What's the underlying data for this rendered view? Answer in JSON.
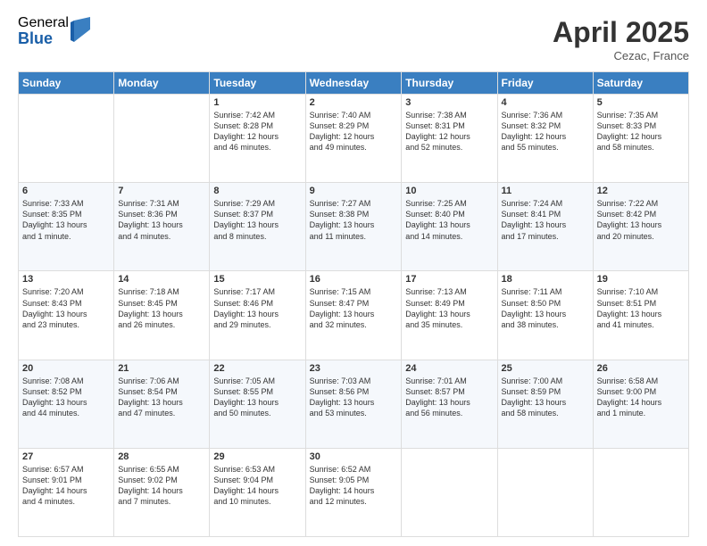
{
  "header": {
    "logo_general": "General",
    "logo_blue": "Blue",
    "month_title": "April 2025",
    "location": "Cezac, France"
  },
  "calendar": {
    "days": [
      "Sunday",
      "Monday",
      "Tuesday",
      "Wednesday",
      "Thursday",
      "Friday",
      "Saturday"
    ],
    "weeks": [
      [
        {
          "num": "",
          "lines": []
        },
        {
          "num": "",
          "lines": []
        },
        {
          "num": "1",
          "lines": [
            "Sunrise: 7:42 AM",
            "Sunset: 8:28 PM",
            "Daylight: 12 hours",
            "and 46 minutes."
          ]
        },
        {
          "num": "2",
          "lines": [
            "Sunrise: 7:40 AM",
            "Sunset: 8:29 PM",
            "Daylight: 12 hours",
            "and 49 minutes."
          ]
        },
        {
          "num": "3",
          "lines": [
            "Sunrise: 7:38 AM",
            "Sunset: 8:31 PM",
            "Daylight: 12 hours",
            "and 52 minutes."
          ]
        },
        {
          "num": "4",
          "lines": [
            "Sunrise: 7:36 AM",
            "Sunset: 8:32 PM",
            "Daylight: 12 hours",
            "and 55 minutes."
          ]
        },
        {
          "num": "5",
          "lines": [
            "Sunrise: 7:35 AM",
            "Sunset: 8:33 PM",
            "Daylight: 12 hours",
            "and 58 minutes."
          ]
        }
      ],
      [
        {
          "num": "6",
          "lines": [
            "Sunrise: 7:33 AM",
            "Sunset: 8:35 PM",
            "Daylight: 13 hours",
            "and 1 minute."
          ]
        },
        {
          "num": "7",
          "lines": [
            "Sunrise: 7:31 AM",
            "Sunset: 8:36 PM",
            "Daylight: 13 hours",
            "and 4 minutes."
          ]
        },
        {
          "num": "8",
          "lines": [
            "Sunrise: 7:29 AM",
            "Sunset: 8:37 PM",
            "Daylight: 13 hours",
            "and 8 minutes."
          ]
        },
        {
          "num": "9",
          "lines": [
            "Sunrise: 7:27 AM",
            "Sunset: 8:38 PM",
            "Daylight: 13 hours",
            "and 11 minutes."
          ]
        },
        {
          "num": "10",
          "lines": [
            "Sunrise: 7:25 AM",
            "Sunset: 8:40 PM",
            "Daylight: 13 hours",
            "and 14 minutes."
          ]
        },
        {
          "num": "11",
          "lines": [
            "Sunrise: 7:24 AM",
            "Sunset: 8:41 PM",
            "Daylight: 13 hours",
            "and 17 minutes."
          ]
        },
        {
          "num": "12",
          "lines": [
            "Sunrise: 7:22 AM",
            "Sunset: 8:42 PM",
            "Daylight: 13 hours",
            "and 20 minutes."
          ]
        }
      ],
      [
        {
          "num": "13",
          "lines": [
            "Sunrise: 7:20 AM",
            "Sunset: 8:43 PM",
            "Daylight: 13 hours",
            "and 23 minutes."
          ]
        },
        {
          "num": "14",
          "lines": [
            "Sunrise: 7:18 AM",
            "Sunset: 8:45 PM",
            "Daylight: 13 hours",
            "and 26 minutes."
          ]
        },
        {
          "num": "15",
          "lines": [
            "Sunrise: 7:17 AM",
            "Sunset: 8:46 PM",
            "Daylight: 13 hours",
            "and 29 minutes."
          ]
        },
        {
          "num": "16",
          "lines": [
            "Sunrise: 7:15 AM",
            "Sunset: 8:47 PM",
            "Daylight: 13 hours",
            "and 32 minutes."
          ]
        },
        {
          "num": "17",
          "lines": [
            "Sunrise: 7:13 AM",
            "Sunset: 8:49 PM",
            "Daylight: 13 hours",
            "and 35 minutes."
          ]
        },
        {
          "num": "18",
          "lines": [
            "Sunrise: 7:11 AM",
            "Sunset: 8:50 PM",
            "Daylight: 13 hours",
            "and 38 minutes."
          ]
        },
        {
          "num": "19",
          "lines": [
            "Sunrise: 7:10 AM",
            "Sunset: 8:51 PM",
            "Daylight: 13 hours",
            "and 41 minutes."
          ]
        }
      ],
      [
        {
          "num": "20",
          "lines": [
            "Sunrise: 7:08 AM",
            "Sunset: 8:52 PM",
            "Daylight: 13 hours",
            "and 44 minutes."
          ]
        },
        {
          "num": "21",
          "lines": [
            "Sunrise: 7:06 AM",
            "Sunset: 8:54 PM",
            "Daylight: 13 hours",
            "and 47 minutes."
          ]
        },
        {
          "num": "22",
          "lines": [
            "Sunrise: 7:05 AM",
            "Sunset: 8:55 PM",
            "Daylight: 13 hours",
            "and 50 minutes."
          ]
        },
        {
          "num": "23",
          "lines": [
            "Sunrise: 7:03 AM",
            "Sunset: 8:56 PM",
            "Daylight: 13 hours",
            "and 53 minutes."
          ]
        },
        {
          "num": "24",
          "lines": [
            "Sunrise: 7:01 AM",
            "Sunset: 8:57 PM",
            "Daylight: 13 hours",
            "and 56 minutes."
          ]
        },
        {
          "num": "25",
          "lines": [
            "Sunrise: 7:00 AM",
            "Sunset: 8:59 PM",
            "Daylight: 13 hours",
            "and 58 minutes."
          ]
        },
        {
          "num": "26",
          "lines": [
            "Sunrise: 6:58 AM",
            "Sunset: 9:00 PM",
            "Daylight: 14 hours",
            "and 1 minute."
          ]
        }
      ],
      [
        {
          "num": "27",
          "lines": [
            "Sunrise: 6:57 AM",
            "Sunset: 9:01 PM",
            "Daylight: 14 hours",
            "and 4 minutes."
          ]
        },
        {
          "num": "28",
          "lines": [
            "Sunrise: 6:55 AM",
            "Sunset: 9:02 PM",
            "Daylight: 14 hours",
            "and 7 minutes."
          ]
        },
        {
          "num": "29",
          "lines": [
            "Sunrise: 6:53 AM",
            "Sunset: 9:04 PM",
            "Daylight: 14 hours",
            "and 10 minutes."
          ]
        },
        {
          "num": "30",
          "lines": [
            "Sunrise: 6:52 AM",
            "Sunset: 9:05 PM",
            "Daylight: 14 hours",
            "and 12 minutes."
          ]
        },
        {
          "num": "",
          "lines": []
        },
        {
          "num": "",
          "lines": []
        },
        {
          "num": "",
          "lines": []
        }
      ]
    ]
  }
}
